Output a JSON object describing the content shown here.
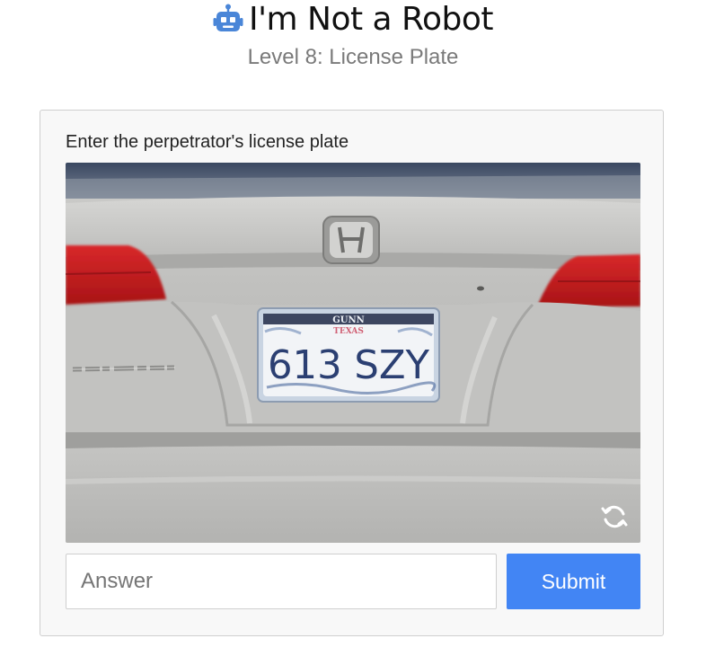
{
  "header": {
    "title": "I'm Not a Robot",
    "subtitle": "Level 8: License Plate",
    "icon": "robot-icon"
  },
  "challenge": {
    "prompt": "Enter the perpetrator's license plate",
    "image": {
      "plate_text": "613 SZY",
      "plate_top_text": "GUNN",
      "plate_state_text": "TEXAS",
      "refresh_icon": "refresh-icon"
    },
    "answer": {
      "placeholder": "Answer",
      "value": ""
    },
    "submit_label": "Submit"
  },
  "colors": {
    "accent": "#4285f4",
    "robot_icon": "#4a86d8"
  }
}
